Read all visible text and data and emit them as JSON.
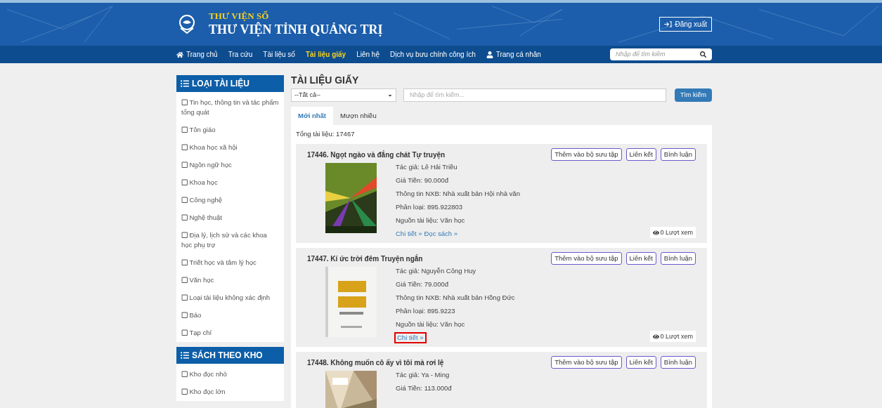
{
  "header": {
    "subtitle": "THƯ VIỆN SỐ",
    "title": "THƯ VIỆN TỈNH QUẢNG TRỊ",
    "logout": "Đăng xuất"
  },
  "nav": {
    "items": [
      {
        "label": "Trang chủ",
        "kind": "home",
        "selected": false
      },
      {
        "label": "Tra cứu",
        "selected": false
      },
      {
        "label": "Tài liệu số",
        "selected": false
      },
      {
        "label": "Tài liệu giấy",
        "selected": true
      },
      {
        "label": "Liên hệ",
        "selected": false
      },
      {
        "label": "Dịch vụ bưu chính công ích",
        "selected": false
      },
      {
        "label": "Trang cá nhân",
        "kind": "user",
        "selected": false
      }
    ],
    "search": {
      "placeholder": "Nhập để tìm kiếm"
    }
  },
  "sidebar": [
    {
      "title": "LOẠI TÀI LIỆU",
      "items": [
        {
          "label": "Tin học, thông tin và tác phẩm tổng quát",
          "checked": false
        },
        {
          "label": "Tôn giáo",
          "checked": false
        },
        {
          "label": "Khoa học xã hội",
          "checked": false
        },
        {
          "label": "Ngôn ngữ học",
          "checked": false
        },
        {
          "label": "Khoa học",
          "checked": false
        },
        {
          "label": "Công nghệ",
          "checked": false
        },
        {
          "label": "Nghệ thuật",
          "checked": false
        },
        {
          "label": "Địa lý, lịch sử và các khoa học phụ trợ",
          "checked": false
        },
        {
          "label": "Triết học và tâm lý học",
          "checked": false
        },
        {
          "label": "Văn học",
          "checked": false
        },
        {
          "label": "Loại tài liệu không xác định",
          "checked": false
        },
        {
          "label": "Báo",
          "checked": false
        },
        {
          "label": "Tạp chí",
          "checked": false
        }
      ]
    },
    {
      "title": "SÁCH THEO KHO",
      "items": [
        {
          "label": "Kho đọc nhỏ",
          "checked": false
        },
        {
          "label": "Kho đọc lớn",
          "checked": false
        }
      ]
    }
  ],
  "main": {
    "title": "TÀI LIỆU GIẤY",
    "filter": {
      "value": "--Tất cả--"
    },
    "search": {
      "placeholder": "Nhập để tìm kiếm...",
      "button": "Tìm kiếm"
    },
    "tabs": [
      {
        "label": "Mới nhất",
        "selected": true
      },
      {
        "label": "Mượn nhiều",
        "selected": false
      }
    ],
    "total": "Tổng tài liệu: 17467",
    "documents": [
      {
        "title": "17446. Ngọt ngào và đắng chát Tự truyện",
        "actions": [
          "Thêm vào bộ sưu tập",
          "Liên kết",
          "Bình luận"
        ],
        "cover": {
          "kind": "picture"
        },
        "fields": [
          "Tác giả: Lê Hải Triều",
          "Giá Tiền: 90.000đ",
          "Thông tin NXB: Nhà xuất bản Hội nhà văn",
          "Phân loại: 895.922803",
          "Nguồn tài liệu: Văn học"
        ],
        "links": [
          {
            "label": "Chi tiết »",
            "highlighted": false
          },
          {
            "label": "Đọc sách »",
            "highlighted": false
          }
        ],
        "views": "0 Lượt xem"
      },
      {
        "title": "17447. Kí ức trời đêm Truyện ngắn",
        "actions": [
          "Thêm vào bộ sưu tập",
          "Liên kết",
          "Bình luận"
        ],
        "cover": {
          "kind": "picture"
        },
        "fields": [
          "Tác giả: Nguyễn Công Huy",
          "Giá Tiền: 79.000đ",
          "Thông tin NXB: Nhà xuất bản Hồng Đức",
          "Phân loại: 895.9223",
          "Nguồn tài liệu: Văn học"
        ],
        "links": [
          {
            "label": "Chi tiết »",
            "highlighted": true
          }
        ],
        "views": "0 Lượt xem"
      },
      {
        "title": "17448. Không muốn cô ấy vì tôi mà rơi lệ",
        "actions": [
          "Thêm vào bộ sưu tập",
          "Liên kết",
          "Bình luận"
        ],
        "cover": {
          "kind": "picture"
        },
        "fields": [
          "Tác giả: Ya - Ming",
          "Giá Tiền: 113.000đ"
        ]
      }
    ]
  }
}
